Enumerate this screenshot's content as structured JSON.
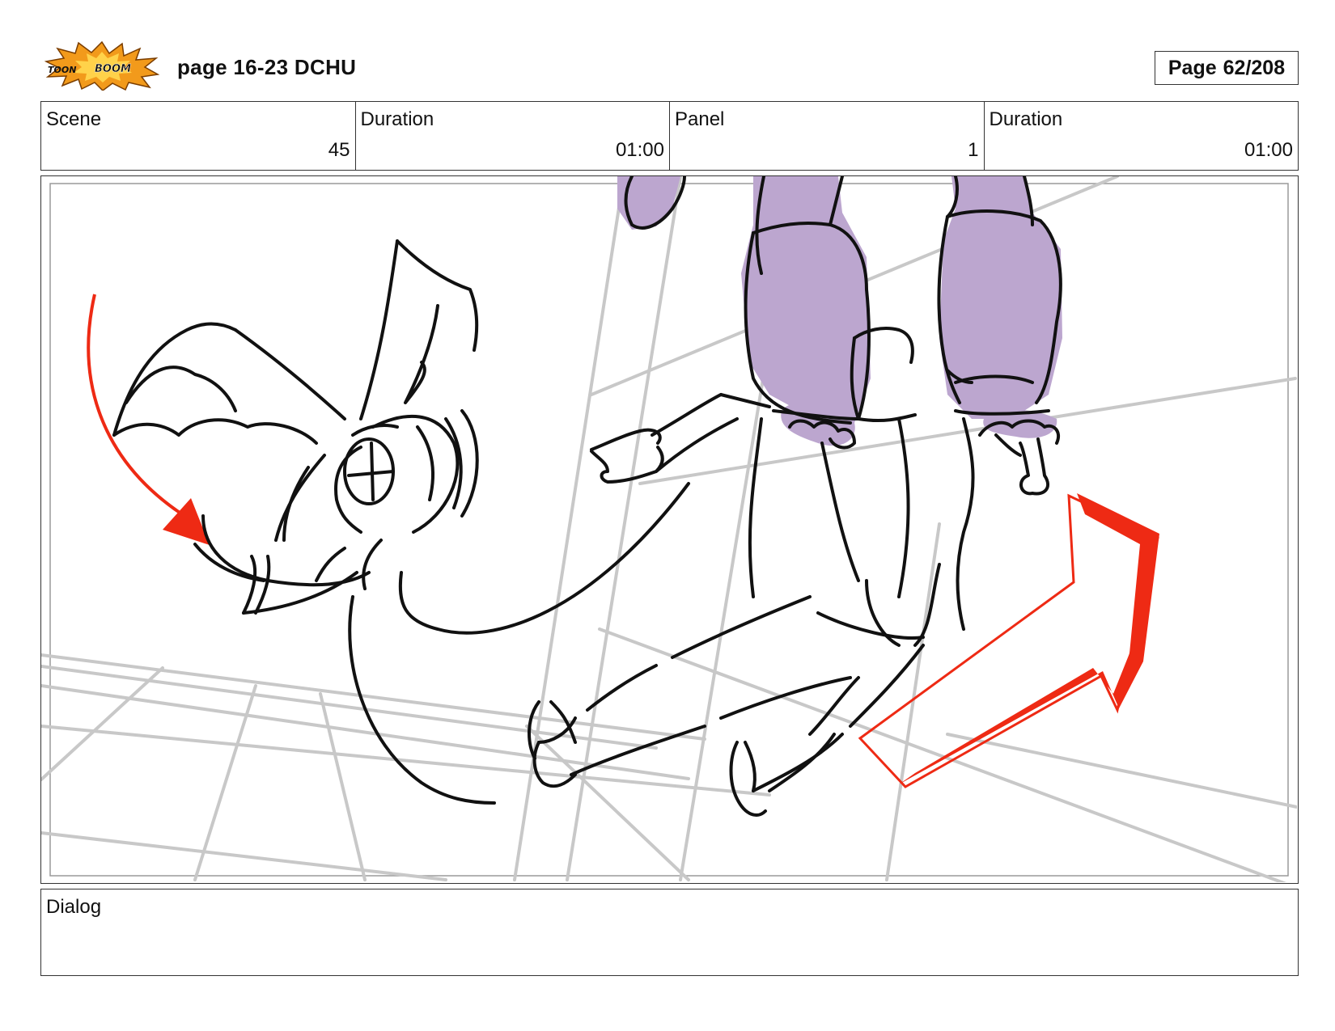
{
  "header": {
    "logo_text_a": "TOON",
    "logo_text_b": "BOOM",
    "title": "page 16-23 DCHU",
    "page_label": "Page",
    "page_number": "62/208"
  },
  "info": {
    "scene_label": "Scene",
    "scene_value": "45",
    "scene_duration_label": "Duration",
    "scene_duration_value": "01:00",
    "panel_label": "Panel",
    "panel_value": "1",
    "panel_duration_label": "Duration",
    "panel_duration_value": "01:00"
  },
  "dialog": {
    "label": "Dialog",
    "text": ""
  },
  "colors": {
    "logo_orange": "#f29a1b",
    "accent_red": "#ee2a14",
    "pants_purple": "#bca6cf",
    "guide_gray": "#c8c8c8",
    "ink": "#111111"
  }
}
